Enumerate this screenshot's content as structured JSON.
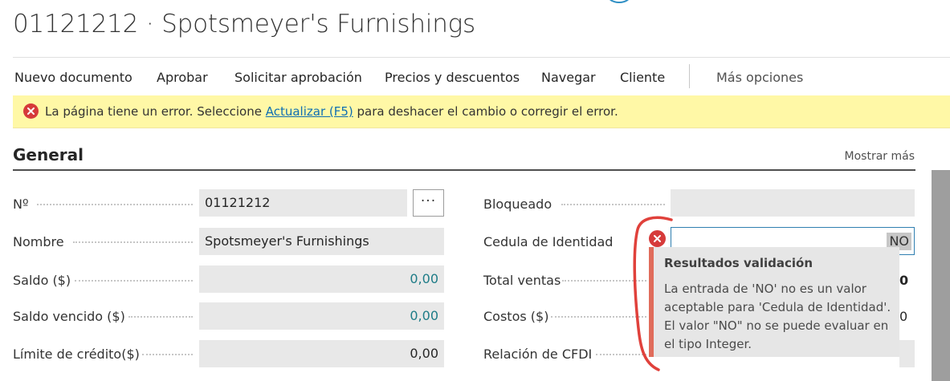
{
  "page": {
    "title": "01121212 · Spotsmeyer's Furnishings"
  },
  "actions": [
    {
      "label": "Nuevo documento"
    },
    {
      "label": "Aprobar"
    },
    {
      "label": "Solicitar aprobación"
    },
    {
      "label": "Precios y descuentos"
    },
    {
      "label": "Navegar"
    },
    {
      "label": "Cliente"
    },
    {
      "label": "Más opciones"
    }
  ],
  "banner": {
    "text_before": "La página tiene un error. Seleccione ",
    "link": "Actualizar (F5)",
    "text_after": " para deshacer el cambio o corregir el error.",
    "icon": "error-circle-icon",
    "color": "#fff8a6"
  },
  "section": {
    "title": "General",
    "show_more": "Mostrar más"
  },
  "left_fields": [
    {
      "label": "Nº",
      "value": "01121212"
    },
    {
      "label": "Nombre",
      "value": "Spotsmeyer's Furnishings"
    },
    {
      "label": "Saldo ($)",
      "value": "0,00"
    },
    {
      "label": "Saldo vencido ($)",
      "value": "0,00"
    },
    {
      "label": "Límite de crédito($)",
      "value": "0,00"
    }
  ],
  "lookup_button": {
    "label": "···"
  },
  "right_fields": [
    {
      "label": "Bloqueado",
      "value": ""
    },
    {
      "label": "Cedula de Identidad",
      "value": "NO"
    },
    {
      "label": "Total ventas",
      "value_peek": "0"
    },
    {
      "label": "Costos ($)",
      "value_peek": "0"
    },
    {
      "label": "Relación de CFDI",
      "value": ""
    }
  ],
  "validation": {
    "title": "Resultados validación",
    "message": "La entrada de 'NO' no es un valor aceptable para 'Cedula de Identidad'. El valor \"NO\" no se puede evaluar en el tipo Integer.",
    "accent_color": "#e06c5b"
  },
  "colors": {
    "teal_value": "#1e7c87",
    "error_red": "#d63a3a"
  }
}
